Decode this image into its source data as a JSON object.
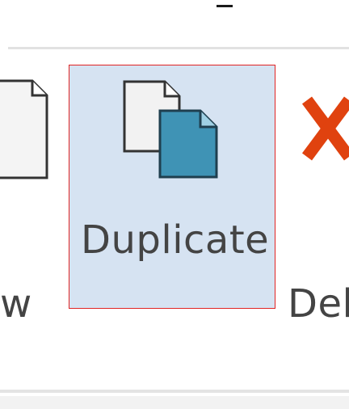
{
  "ribbon": {
    "buttons": [
      {
        "id": "new",
        "label": "w",
        "icon": "document-icon"
      },
      {
        "id": "duplicate",
        "label": "Duplicate",
        "icon": "duplicate-icon",
        "selected": true
      },
      {
        "id": "delete",
        "label": "Del",
        "icon": "delete-x-icon"
      }
    ]
  },
  "colors": {
    "selected_bg": "#d6e3f2",
    "selected_border": "#e02424",
    "label": "#444444",
    "delete_red": "#e0420f",
    "doc_blue": "#3f93b5"
  }
}
